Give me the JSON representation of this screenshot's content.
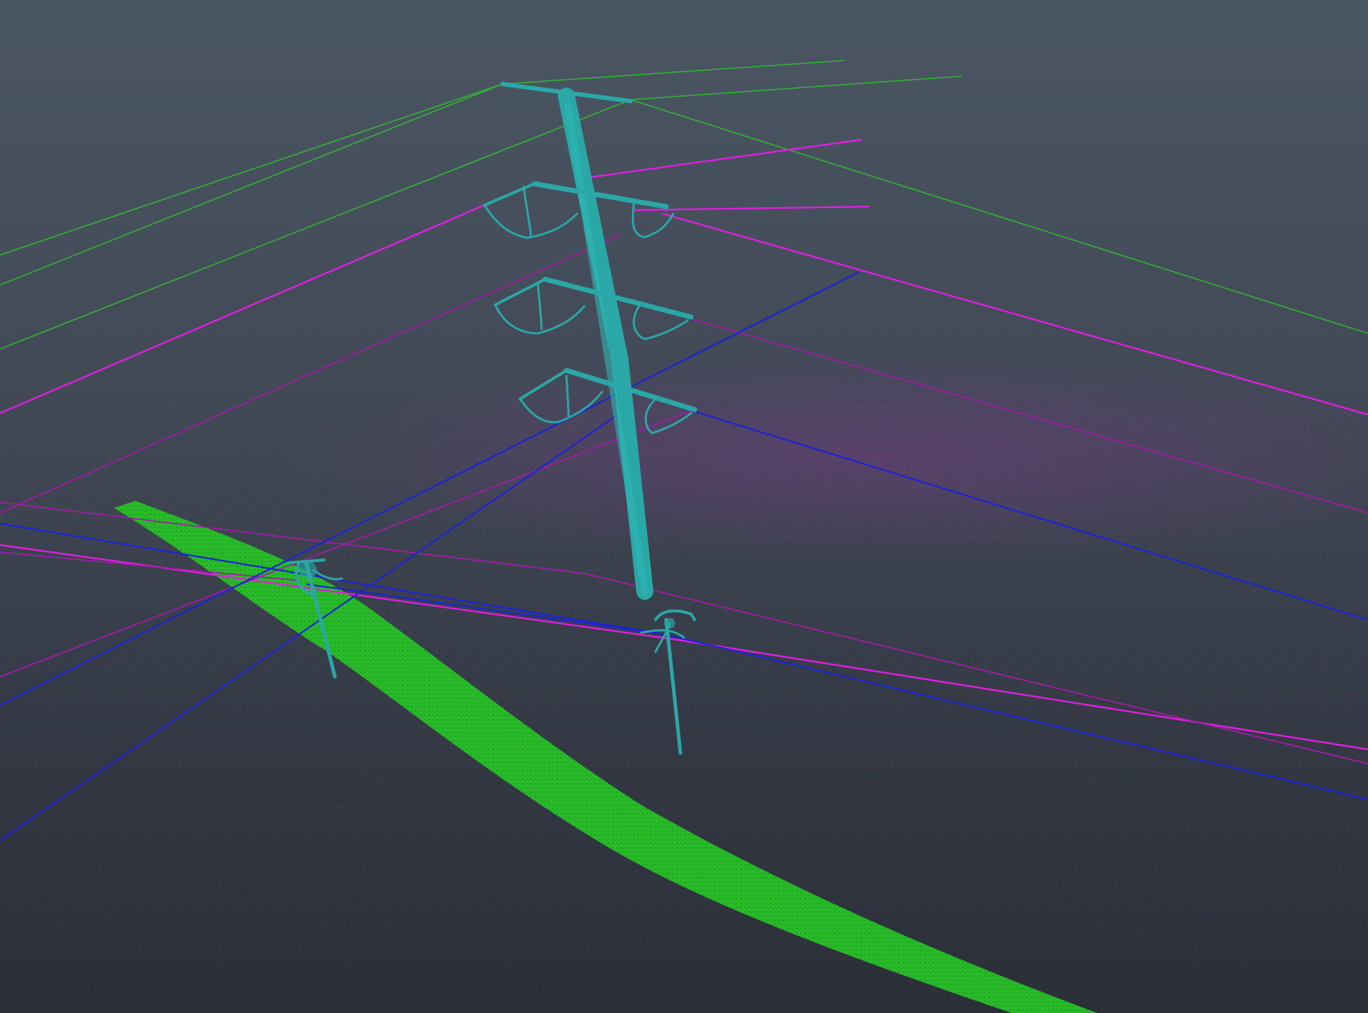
{
  "viewer": {
    "view": "3d-perspective",
    "background_top": "#4b5663",
    "background_bottom": "#2b2f37"
  },
  "classes": {
    "ground_wire": "#2fbf2f",
    "upper_conductor": "#e01ee0",
    "lower_conductor": "#a21ca8",
    "distribution_wire": "#1b23d9",
    "pylon": "#2aa7a7",
    "vegetation_strip": "#27c227",
    "ground_noise": "#c02fc0"
  },
  "icons": {
    "pylon": "pylon-icon",
    "pole": "utility-pole-icon"
  }
}
